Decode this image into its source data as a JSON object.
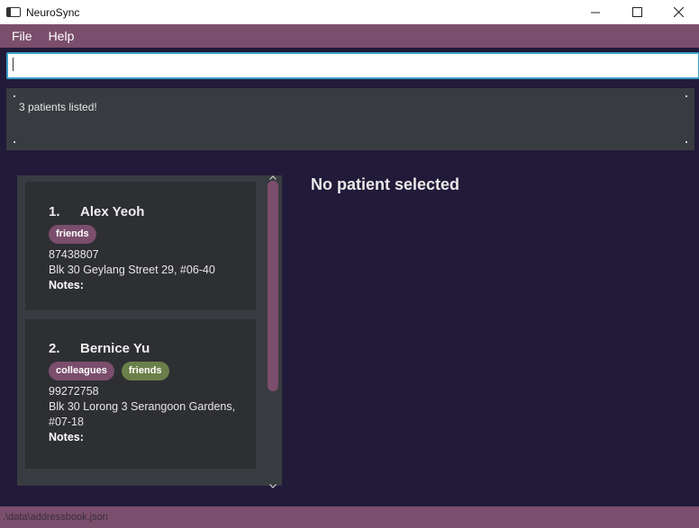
{
  "window": {
    "title": "NeuroSync"
  },
  "menu": {
    "items": [
      "File",
      "Help"
    ]
  },
  "command": {
    "value": "",
    "placeholder": ""
  },
  "result": {
    "message": "3 patients listed!"
  },
  "patients": [
    {
      "index": "1.",
      "name": "Alex Yeoh",
      "tags": [
        "friends"
      ],
      "phone": "87438807",
      "address_lines": [
        "Blk 30 Geylang Street 29, #06-40"
      ],
      "notes_label": "Notes:"
    },
    {
      "index": "2.",
      "name": "Bernice Yu",
      "tags": [
        "colleagues",
        "friends"
      ],
      "phone": "99272758",
      "address_lines": [
        "Blk 30 Lorong 3 Serangoon Gardens,",
        "#07-18"
      ],
      "notes_label": "Notes:"
    }
  ],
  "detail": {
    "empty_message": "No patient selected"
  },
  "status": {
    "path": ".\\data\\addressbook.json"
  },
  "colors": {
    "background": "#221a39",
    "accent": "#7a4e6c",
    "panel": "#383c40",
    "card": "#2e2f33",
    "tag_friends": "#7a4e6c",
    "tag_green": "#6b7f4a",
    "focus_border": "#3aa0c8"
  },
  "icons": {
    "app": "app-window-icon",
    "minimize": "minimize-icon",
    "maximize": "maximize-icon",
    "close": "close-icon"
  }
}
